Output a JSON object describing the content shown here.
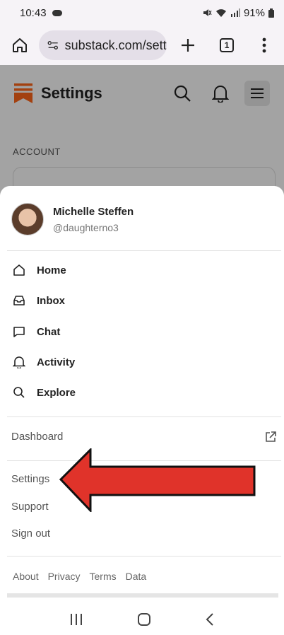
{
  "status_bar": {
    "time": "10:43",
    "battery": "91%"
  },
  "browser": {
    "url": "substack.com/settings",
    "tab_count": "1"
  },
  "site": {
    "title": "Settings",
    "section_label": "ACCOUNT"
  },
  "profile": {
    "name": "Michelle Steffen",
    "handle": "@daughterno3"
  },
  "nav": [
    {
      "label": "Home",
      "icon": "home-icon"
    },
    {
      "label": "Inbox",
      "icon": "inbox-icon"
    },
    {
      "label": "Chat",
      "icon": "chat-icon"
    },
    {
      "label": "Activity",
      "icon": "bell-icon"
    },
    {
      "label": "Explore",
      "icon": "search-icon"
    }
  ],
  "links": {
    "dashboard": "Dashboard",
    "settings": "Settings",
    "support": "Support",
    "sign_out": "Sign out"
  },
  "footer": [
    "About",
    "Privacy",
    "Terms",
    "Data"
  ],
  "colors": {
    "brand": "#ff6719",
    "arrow": "#e0332a",
    "overlay": "rgba(0,0,0,0.36)"
  }
}
